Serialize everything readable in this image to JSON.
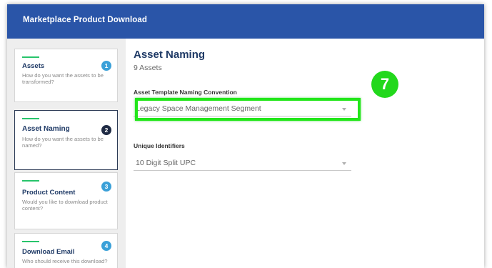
{
  "window": {
    "title": "Marketplace Product Download"
  },
  "steps": [
    {
      "title": "Assets",
      "number": "1",
      "description": "How do you want the assets to be transformed?"
    },
    {
      "title": "Asset Naming",
      "number": "2",
      "description": "How do you want the assets to be named?"
    },
    {
      "title": "Product Content",
      "number": "3",
      "description": "Would you like to download product content?"
    },
    {
      "title": "Download Email",
      "number": "4",
      "description": "Who should receive this download?"
    }
  ],
  "main": {
    "title": "Asset Naming",
    "subtitle": "9 Assets",
    "naming_convention": {
      "label": "Asset Template Naming Convention",
      "value": "Legacy Space Management Segment"
    },
    "unique_identifiers": {
      "label": "Unique Identifiers",
      "value": "10 Digit Split UPC"
    }
  },
  "callout": {
    "number": "7"
  },
  "colors": {
    "header": "#2a55a8",
    "highlight": "#22e61a",
    "badge": "#3aa0d8",
    "badge_active": "#1f2b44",
    "step_bar": "#27c46b"
  },
  "icons": [
    "chevron-down-icon"
  ]
}
